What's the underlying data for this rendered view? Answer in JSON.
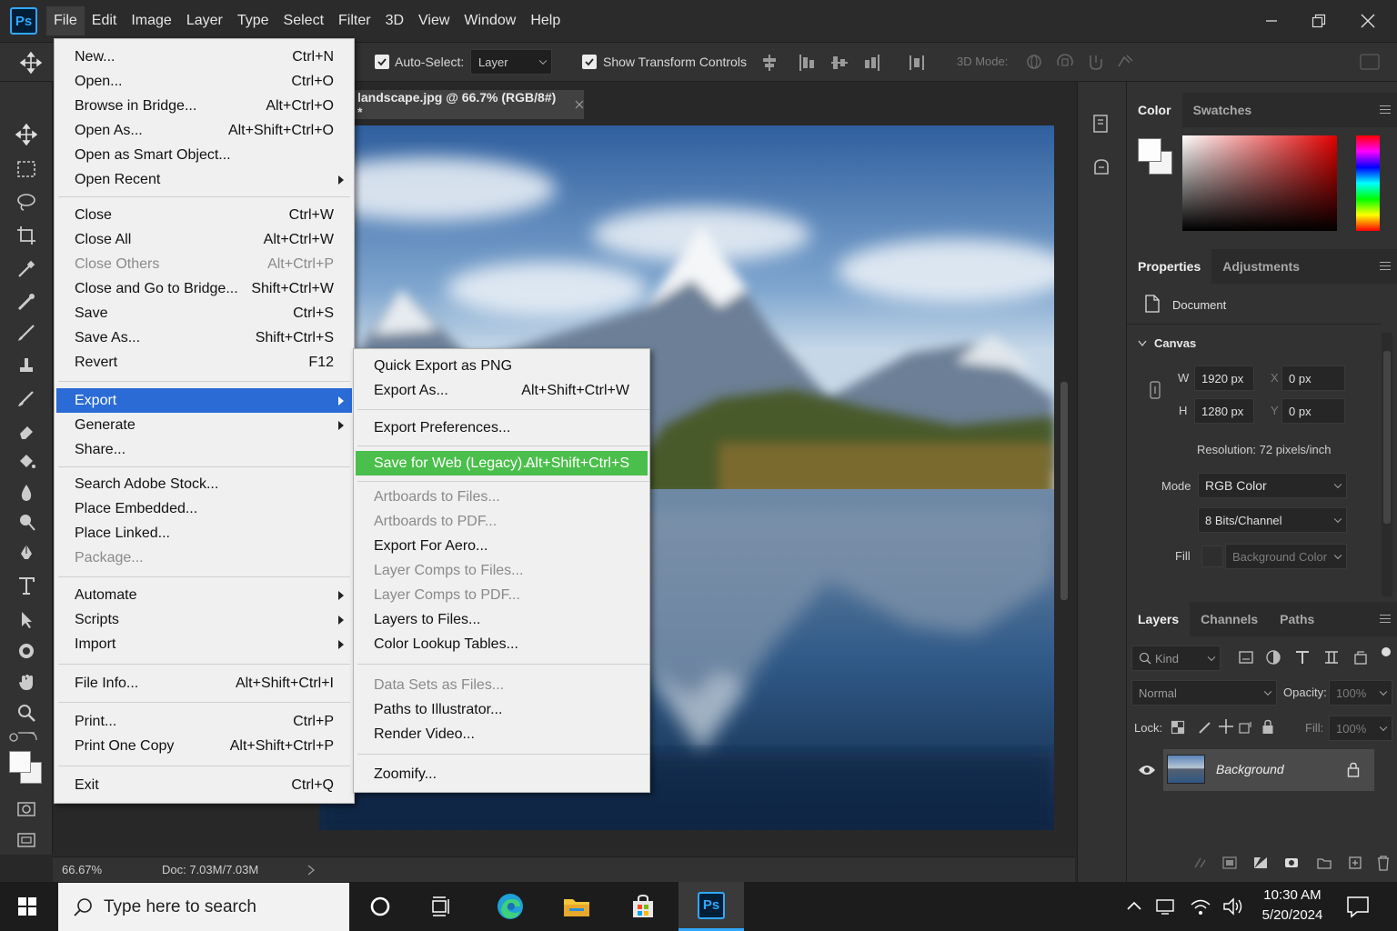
{
  "app": {
    "logo": "Ps",
    "menus": [
      "File",
      "Edit",
      "Image",
      "Layer",
      "Type",
      "Select",
      "Filter",
      "3D",
      "View",
      "Window",
      "Help"
    ]
  },
  "options_bar": {
    "auto_select_label": "Auto-Select:",
    "auto_select_value": "Layer",
    "show_transform_label": "Show Transform Controls",
    "mode_3d_label": "3D Mode:"
  },
  "document": {
    "tab_title": "landscape.jpg @ 66.7% (RGB/8#) *"
  },
  "status_bar": {
    "zoom": "66.67%",
    "doc_info": "Doc: 7.03M/7.03M"
  },
  "file_menu": {
    "items": [
      {
        "label": "New...",
        "shortcut": "Ctrl+N"
      },
      {
        "label": "Open...",
        "shortcut": "Ctrl+O"
      },
      {
        "label": "Browse in Bridge...",
        "shortcut": "Alt+Ctrl+O"
      },
      {
        "label": "Open As...",
        "shortcut": "Alt+Shift+Ctrl+O"
      },
      {
        "label": "Open as Smart Object...",
        "shortcut": ""
      },
      {
        "label": "Open Recent",
        "shortcut": ""
      },
      {
        "label": "Close",
        "shortcut": "Ctrl+W"
      },
      {
        "label": "Close All",
        "shortcut": "Alt+Ctrl+W"
      },
      {
        "label": "Close Others",
        "shortcut": "Alt+Ctrl+P"
      },
      {
        "label": "Close and Go to Bridge...",
        "shortcut": "Shift+Ctrl+W"
      },
      {
        "label": "Save",
        "shortcut": "Ctrl+S"
      },
      {
        "label": "Save As...",
        "shortcut": "Shift+Ctrl+S"
      },
      {
        "label": "Revert",
        "shortcut": "F12"
      },
      {
        "label": "Export",
        "shortcut": ""
      },
      {
        "label": "Generate",
        "shortcut": ""
      },
      {
        "label": "Share...",
        "shortcut": ""
      },
      {
        "label": "Search Adobe Stock...",
        "shortcut": ""
      },
      {
        "label": "Place Embedded...",
        "shortcut": ""
      },
      {
        "label": "Place Linked...",
        "shortcut": ""
      },
      {
        "label": "Package...",
        "shortcut": ""
      },
      {
        "label": "Automate",
        "shortcut": ""
      },
      {
        "label": "Scripts",
        "shortcut": ""
      },
      {
        "label": "Import",
        "shortcut": ""
      },
      {
        "label": "File Info...",
        "shortcut": "Alt+Shift+Ctrl+I"
      },
      {
        "label": "Print...",
        "shortcut": "Ctrl+P"
      },
      {
        "label": "Print One Copy",
        "shortcut": "Alt+Shift+Ctrl+P"
      },
      {
        "label": "Exit",
        "shortcut": "Ctrl+Q"
      }
    ]
  },
  "export_submenu": {
    "items": [
      {
        "label": "Quick Export as PNG",
        "shortcut": ""
      },
      {
        "label": "Export As...",
        "shortcut": "Alt+Shift+Ctrl+W"
      },
      {
        "label": "Export Preferences...",
        "shortcut": ""
      },
      {
        "label": "Save for Web (Legacy)...",
        "shortcut": "Alt+Shift+Ctrl+S"
      },
      {
        "label": "Artboards to Files...",
        "shortcut": ""
      },
      {
        "label": "Artboards to PDF...",
        "shortcut": ""
      },
      {
        "label": "Export For Aero...",
        "shortcut": ""
      },
      {
        "label": "Layer Comps to Files...",
        "shortcut": ""
      },
      {
        "label": "Layer Comps to PDF...",
        "shortcut": ""
      },
      {
        "label": "Layers to Files...",
        "shortcut": ""
      },
      {
        "label": "Color Lookup Tables...",
        "shortcut": ""
      },
      {
        "label": "Data Sets as Files...",
        "shortcut": ""
      },
      {
        "label": "Paths to Illustrator...",
        "shortcut": ""
      },
      {
        "label": "Render Video...",
        "shortcut": ""
      },
      {
        "label": "Zoomify...",
        "shortcut": ""
      }
    ]
  },
  "color_panel": {
    "tabs": [
      "Color",
      "Swatches"
    ]
  },
  "properties_panel": {
    "tabs": [
      "Properties",
      "Adjustments"
    ],
    "document_label": "Document",
    "canvas_label": "Canvas",
    "w_label": "W",
    "w_value": "1920 px",
    "h_label": "H",
    "h_value": "1280 px",
    "x_label": "X",
    "x_value": "0 px",
    "y_label": "Y",
    "y_value": "0 px",
    "resolution": "Resolution: 72 pixels/inch",
    "mode_label": "Mode",
    "mode_value": "RGB Color",
    "bits_value": "8 Bits/Channel",
    "fill_label": "Fill",
    "fill_value": "Background Color"
  },
  "layers_panel": {
    "tabs": [
      "Layers",
      "Channels",
      "Paths"
    ],
    "kind_label": "Kind",
    "blend_mode": "Normal",
    "opacity_label": "Opacity:",
    "opacity_value": "100%",
    "lock_label": "Lock:",
    "fill_label": "Fill:",
    "fill_value": "100%",
    "layer_name": "Background"
  },
  "taskbar": {
    "search_placeholder": "Type here to search",
    "time": "10:30 AM",
    "date": "5/20/2024",
    "app_label": "Ps"
  },
  "colors": {
    "accent_blue": "#2a6bd6",
    "highlight_green": "#4bbf4b",
    "ps_blue": "#31a8ff"
  }
}
